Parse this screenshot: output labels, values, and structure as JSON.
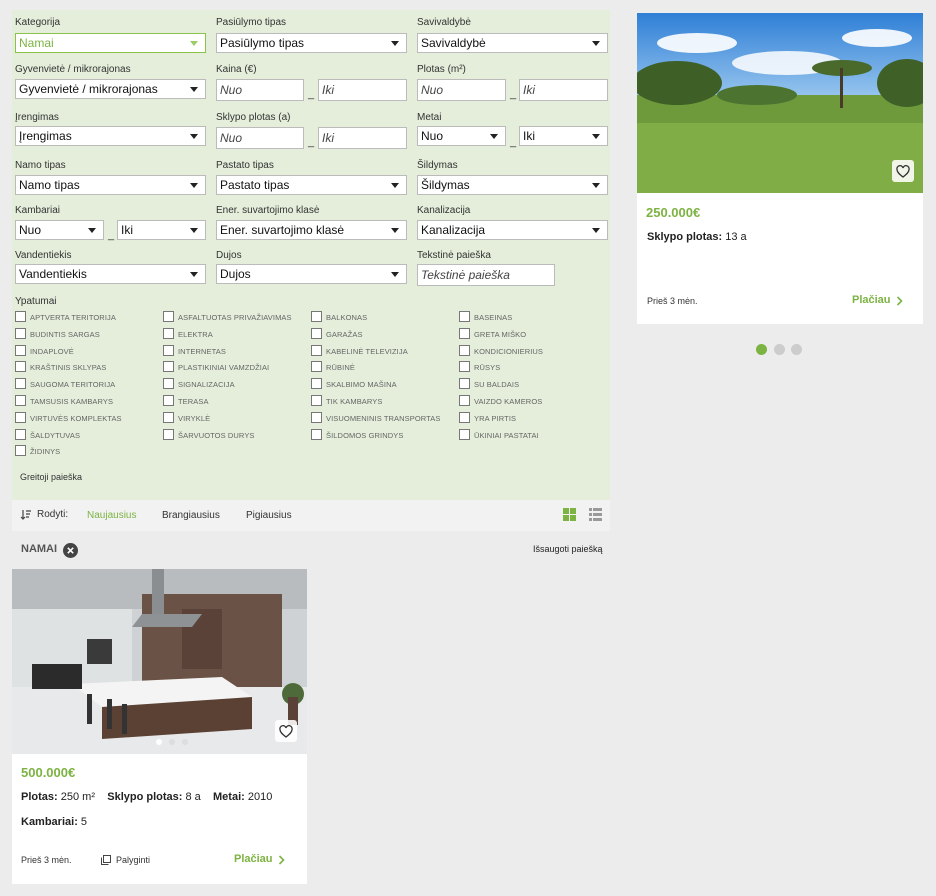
{
  "filters": {
    "kategorija": {
      "label": "Kategorija",
      "value": "Namai"
    },
    "pasiulymo_tipas": {
      "label": "Pasiūlymo tipas",
      "value": "Pasiūlymo tipas"
    },
    "savivaldybe": {
      "label": "Savivaldybė",
      "value": "Savivaldybė"
    },
    "gyvenviete": {
      "label": "Gyvenvietė / mikrorajonas",
      "value": "Gyvenvietė / mikrorajonas"
    },
    "kaina": {
      "label": "Kaina (€)",
      "from": "Nuo",
      "to": "Iki"
    },
    "plotas": {
      "label": "Plotas (m²)",
      "from": "Nuo",
      "to": "Iki"
    },
    "irengimas": {
      "label": "Įrengimas",
      "value": "Įrengimas"
    },
    "sklypo_plotas": {
      "label": "Sklypo plotas (a)",
      "from": "Nuo",
      "to": "Iki"
    },
    "metai": {
      "label": "Metai",
      "from": "Nuo",
      "to": "Iki"
    },
    "namo_tipas": {
      "label": "Namo tipas",
      "value": "Namo tipas"
    },
    "pastato_tipas": {
      "label": "Pastato tipas",
      "value": "Pastato tipas"
    },
    "sildymas": {
      "label": "Šildymas",
      "value": "Šildymas"
    },
    "kambariai": {
      "label": "Kambariai",
      "from": "Nuo",
      "to": "Iki"
    },
    "ener": {
      "label": "Ener. suvartojimo klasė",
      "value": "Ener. suvartojimo klasė"
    },
    "kanalizacija": {
      "label": "Kanalizacija",
      "value": "Kanalizacija"
    },
    "vandentiekis": {
      "label": "Vandentiekis",
      "value": "Vandentiekis"
    },
    "dujos": {
      "label": "Dujos",
      "value": "Dujos"
    },
    "tekstine": {
      "label": "Tekstinė paieška",
      "placeholder": "Tekstinė paieška"
    },
    "dash": "_",
    "ypatumai_label": "Ypatumai",
    "ypatumai": [
      "APTVERTA TERITORIJA",
      "ASFALTUOTAS PRIVAŽIAVIMAS",
      "BALKONAS",
      "BASEINAS",
      "BUDINTIS SARGAS",
      "ELEKTRA",
      "GARAŽAS",
      "GRETA MIŠKO",
      "INDAPLOVĖ",
      "INTERNETAS",
      "KABELINĖ TELEVIZIJA",
      "KONDICIONIERIUS",
      "KRAŠTINIS SKLYPAS",
      "PLASTIKINIAI VAMZDŽIAI",
      "RŪBINĖ",
      "RŪSYS",
      "SAUGOMA TERITORIJA",
      "SIGNALIZACIJA",
      "SKALBIMO MAŠINA",
      "SU BALDAIS",
      "TAMSUSIS KAMBARYS",
      "TERASA",
      "TIK KAMBARYS",
      "VAIZDO KAMEROS",
      "VIRTUVĖS KOMPLEKTAS",
      "VIRYKLĖ",
      "VISUOMENINIS TRANSPORTAS",
      "YRA PIRTIS",
      "ŠALDYTUVAS",
      "ŠARVUOTOS DURYS",
      "ŠILDOMOS GRINDYS",
      "ŪKINIAI PASTATAI",
      "ŽIDINYS"
    ],
    "quick_search": "Greitoji paieška"
  },
  "sort": {
    "label": "Rodyti:",
    "options": [
      "Naujausius",
      "Brangiausius",
      "Pigiausius"
    ],
    "active_index": 0
  },
  "tag": {
    "label": "NAMAI",
    "save_search": "Išsaugoti paiešką"
  },
  "listing": {
    "price": "500.000€",
    "plotas_label": "Plotas:",
    "plotas_value": "250 m²",
    "sklypo_label": "Sklypo plotas:",
    "sklypo_value": "8 a",
    "metai_label": "Metai:",
    "metai_value": "2010",
    "kambariai_label": "Kambariai:",
    "kambariai_value": "5",
    "time": "Prieš 3 mėn.",
    "compare": "Palyginti",
    "more": "Plačiau",
    "image_alt": "Interior kitchen photo"
  },
  "featured": {
    "price": "250.000€",
    "sklypo_label": "Sklypo plotas:",
    "sklypo_value": "13 a",
    "time": "Prieš 3 mėn.",
    "more": "Plačiau"
  },
  "colors": {
    "accent": "#7cb342",
    "filter_bg": "#e4eedb",
    "page_bg": "#ececec"
  }
}
